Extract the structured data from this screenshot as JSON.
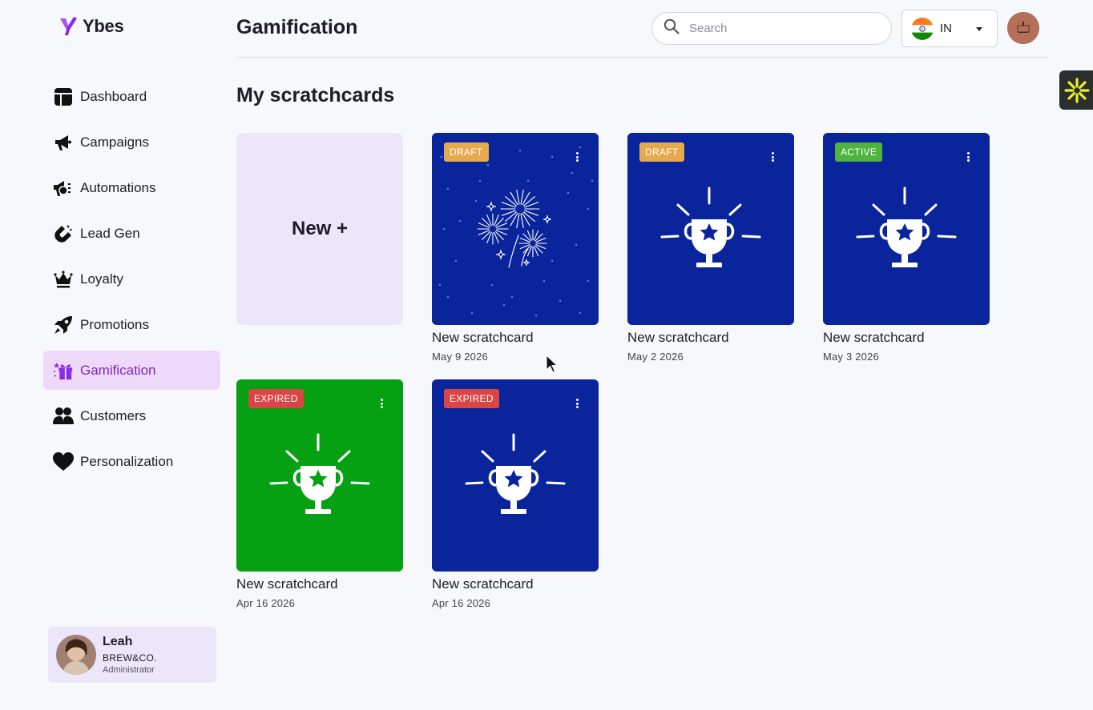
{
  "app": {
    "name": "Ybes"
  },
  "nav": [
    {
      "label": "Dashboard",
      "icon": "dashboard-icon"
    },
    {
      "label": "Campaigns",
      "icon": "megaphone-icon"
    },
    {
      "label": "Automations",
      "icon": "automations-icon"
    },
    {
      "label": "Lead Gen",
      "icon": "magnet-icon"
    },
    {
      "label": "Loyalty",
      "icon": "crown-icon"
    },
    {
      "label": "Promotions",
      "icon": "rocket-icon"
    },
    {
      "label": "Gamification",
      "icon": "gift-icon",
      "active": true
    },
    {
      "label": "Customers",
      "icon": "users-icon"
    },
    {
      "label": "Personalization",
      "icon": "heart-icon"
    }
  ],
  "header": {
    "title": "Gamification",
    "search_placeholder": "Search",
    "country_code": "IN"
  },
  "user": {
    "name": "Leah",
    "company": "BREW&CO.",
    "role": "Administrator"
  },
  "section_title": "My scratchcards",
  "new_card_label": "New +",
  "cards": [
    {
      "status": "DRAFT",
      "title": "New scratchcard",
      "date": "May 9 2026",
      "art": "fireworks"
    },
    {
      "status": "DRAFT",
      "title": "New scratchcard",
      "date": "May 2 2026",
      "art": "trophy"
    },
    {
      "status": "ACTIVE",
      "title": "New scratchcard",
      "date": "May 3 2026",
      "art": "trophy"
    },
    {
      "status": "EXPIRED",
      "title": "New scratchcard",
      "date": "Apr 16 2026",
      "art": "trophy"
    },
    {
      "status": "EXPIRED",
      "title": "New scratchcard",
      "date": "Apr 16 2026",
      "art": "trophy"
    }
  ],
  "colors": {
    "card_blue": "#0a249c",
    "card_green": "#05a113",
    "draft_badge": "#e7a94e",
    "active_badge": "#4fb33d",
    "expired_badge": "#dc4545",
    "nav_active_bg": "#efd9fb",
    "nav_active_text": "#7b2bb3",
    "new_card_bg": "#ebe6fa"
  }
}
